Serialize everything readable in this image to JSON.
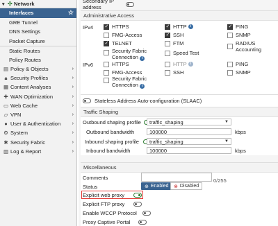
{
  "sidebar": {
    "network_label": "Network",
    "sub_items": [
      "Interfaces",
      "GRE Tunnel",
      "DNS Settings",
      "Packet Capture",
      "Static Routes",
      "Policy Routes"
    ],
    "items": [
      {
        "label": "Policy & Objects",
        "icon": "clipboard-icon"
      },
      {
        "label": "Security Profiles",
        "icon": "lock-icon"
      },
      {
        "label": "Content Analyses",
        "icon": "chart-icon"
      },
      {
        "label": "WAN Optimization",
        "icon": "wan-icon"
      },
      {
        "label": "Web Cache",
        "icon": "monitor-icon"
      },
      {
        "label": "VPN",
        "icon": "laptop-icon"
      },
      {
        "label": "User & Authentication",
        "icon": "user-icon"
      },
      {
        "label": "System",
        "icon": "gear-icon"
      },
      {
        "label": "Security Fabric",
        "icon": "fabric-icon"
      },
      {
        "label": "Log & Report",
        "icon": "log-icon"
      }
    ]
  },
  "top_partial": "Secondary IP address",
  "admin_access": {
    "title": "Administrative Access",
    "ipv4_label": "IPv4",
    "ipv6_label": "IPv6",
    "ipv4": [
      {
        "label": "HTTPS",
        "checked": true
      },
      {
        "label": "HTTP",
        "checked": true,
        "info": true
      },
      {
        "label": "PING",
        "checked": true
      },
      {
        "label": "FMG-Access",
        "checked": false
      },
      {
        "label": "SSH",
        "checked": true
      },
      {
        "label": "SNMP",
        "checked": false
      },
      {
        "label": "TELNET",
        "checked": true
      },
      {
        "label": "FTM",
        "checked": false
      },
      {
        "label": "RADIUS Accounting",
        "checked": false
      },
      {
        "label": "Security Fabric",
        "label2": "Connection",
        "checked": false,
        "info": true
      },
      {
        "label": "Speed Test",
        "checked": false
      }
    ],
    "ipv6": [
      {
        "label": "HTTPS",
        "checked": false
      },
      {
        "label": "HTTP",
        "checked": false,
        "info": true
      },
      {
        "label": "PING",
        "checked": false
      },
      {
        "label": "FMG-Access",
        "checked": false
      },
      {
        "label": "SSH",
        "checked": false
      },
      {
        "label": "SNMP",
        "checked": false
      },
      {
        "label": "Security Fabric",
        "label2": "Connection",
        "checked": false,
        "info": true
      }
    ]
  },
  "slaac_label": "Stateless Address Auto-configuration (SLAAC)",
  "traffic_shaping": {
    "title": "Traffic Shaping",
    "outbound_profile_label": "Outbound shaping profile",
    "outbound_profile_value": "traffic_shaping",
    "outbound_bw_label": "Outbound bandwidth",
    "outbound_bw_value": "100000",
    "inbound_profile_label": "Inbound shaping profile",
    "inbound_profile_value": "traffic_shaping",
    "inbound_bw_label": "Inbound bandwidth",
    "inbound_bw_value": "100000",
    "unit": "kbps"
  },
  "misc": {
    "title": "Miscellaneous",
    "comments_label": "Comments",
    "comments_counter": "0/255",
    "status_label": "Status",
    "enabled_label": "Enabled",
    "disabled_label": "Disabled",
    "explicit_web_proxy": "Explicit web proxy",
    "explicit_ftp_proxy": "Explicit FTP proxy",
    "wccp": "Enable WCCP Protocol",
    "captive_portal": "Proxy Captive Portal"
  }
}
